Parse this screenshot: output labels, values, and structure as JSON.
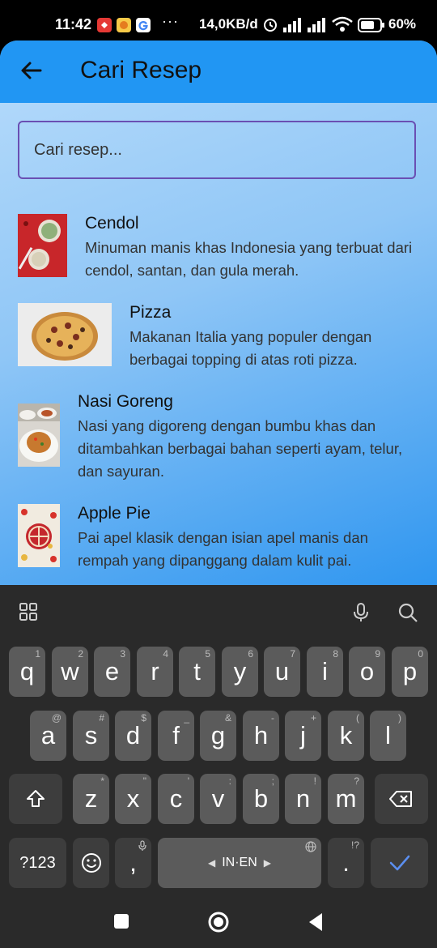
{
  "status_bar": {
    "time": "11:42",
    "dots": "···",
    "speed": "14,0KB/d",
    "battery": "60%"
  },
  "app_bar": {
    "title": "Cari Resep"
  },
  "search": {
    "placeholder": "Cari resep..."
  },
  "recipes": [
    {
      "title": "Cendol",
      "description": "Minuman manis khas Indonesia yang terbuat dari cendol, santan, dan gula merah."
    },
    {
      "title": "Pizza",
      "description": "Makanan Italia yang populer dengan berbagai topping di atas roti pizza."
    },
    {
      "title": "Nasi Goreng",
      "description": "Nasi yang digoreng dengan bumbu khas dan ditambahkan berbagai bahan seperti ayam, telur, dan sayuran."
    },
    {
      "title": "Apple Pie",
      "description": "Pai apel klasik dengan isian apel manis dan rempah yang dipanggang dalam kulit pai."
    }
  ],
  "keyboard": {
    "row1": [
      {
        "k": "q",
        "h": "1"
      },
      {
        "k": "w",
        "h": "2"
      },
      {
        "k": "e",
        "h": "3"
      },
      {
        "k": "r",
        "h": "4"
      },
      {
        "k": "t",
        "h": "5"
      },
      {
        "k": "y",
        "h": "6"
      },
      {
        "k": "u",
        "h": "7"
      },
      {
        "k": "i",
        "h": "8"
      },
      {
        "k": "o",
        "h": "9"
      },
      {
        "k": "p",
        "h": "0"
      }
    ],
    "row2": [
      {
        "k": "a",
        "h": "@"
      },
      {
        "k": "s",
        "h": "#"
      },
      {
        "k": "d",
        "h": "$"
      },
      {
        "k": "f",
        "h": "_"
      },
      {
        "k": "g",
        "h": "&"
      },
      {
        "k": "h",
        "h": "-"
      },
      {
        "k": "j",
        "h": "+"
      },
      {
        "k": "k",
        "h": "("
      },
      {
        "k": "l",
        "h": ")"
      }
    ],
    "row3": [
      {
        "k": "z",
        "h": "*"
      },
      {
        "k": "x",
        "h": "\""
      },
      {
        "k": "c",
        "h": "'"
      },
      {
        "k": "v",
        "h": ":"
      },
      {
        "k": "b",
        "h": ";"
      },
      {
        "k": "n",
        "h": "!"
      },
      {
        "k": "m",
        "h": "?"
      }
    ],
    "symbols_label": "?123",
    "comma": ",",
    "space_label": "IN·EN",
    "period": ".",
    "period_hint": "!?"
  }
}
